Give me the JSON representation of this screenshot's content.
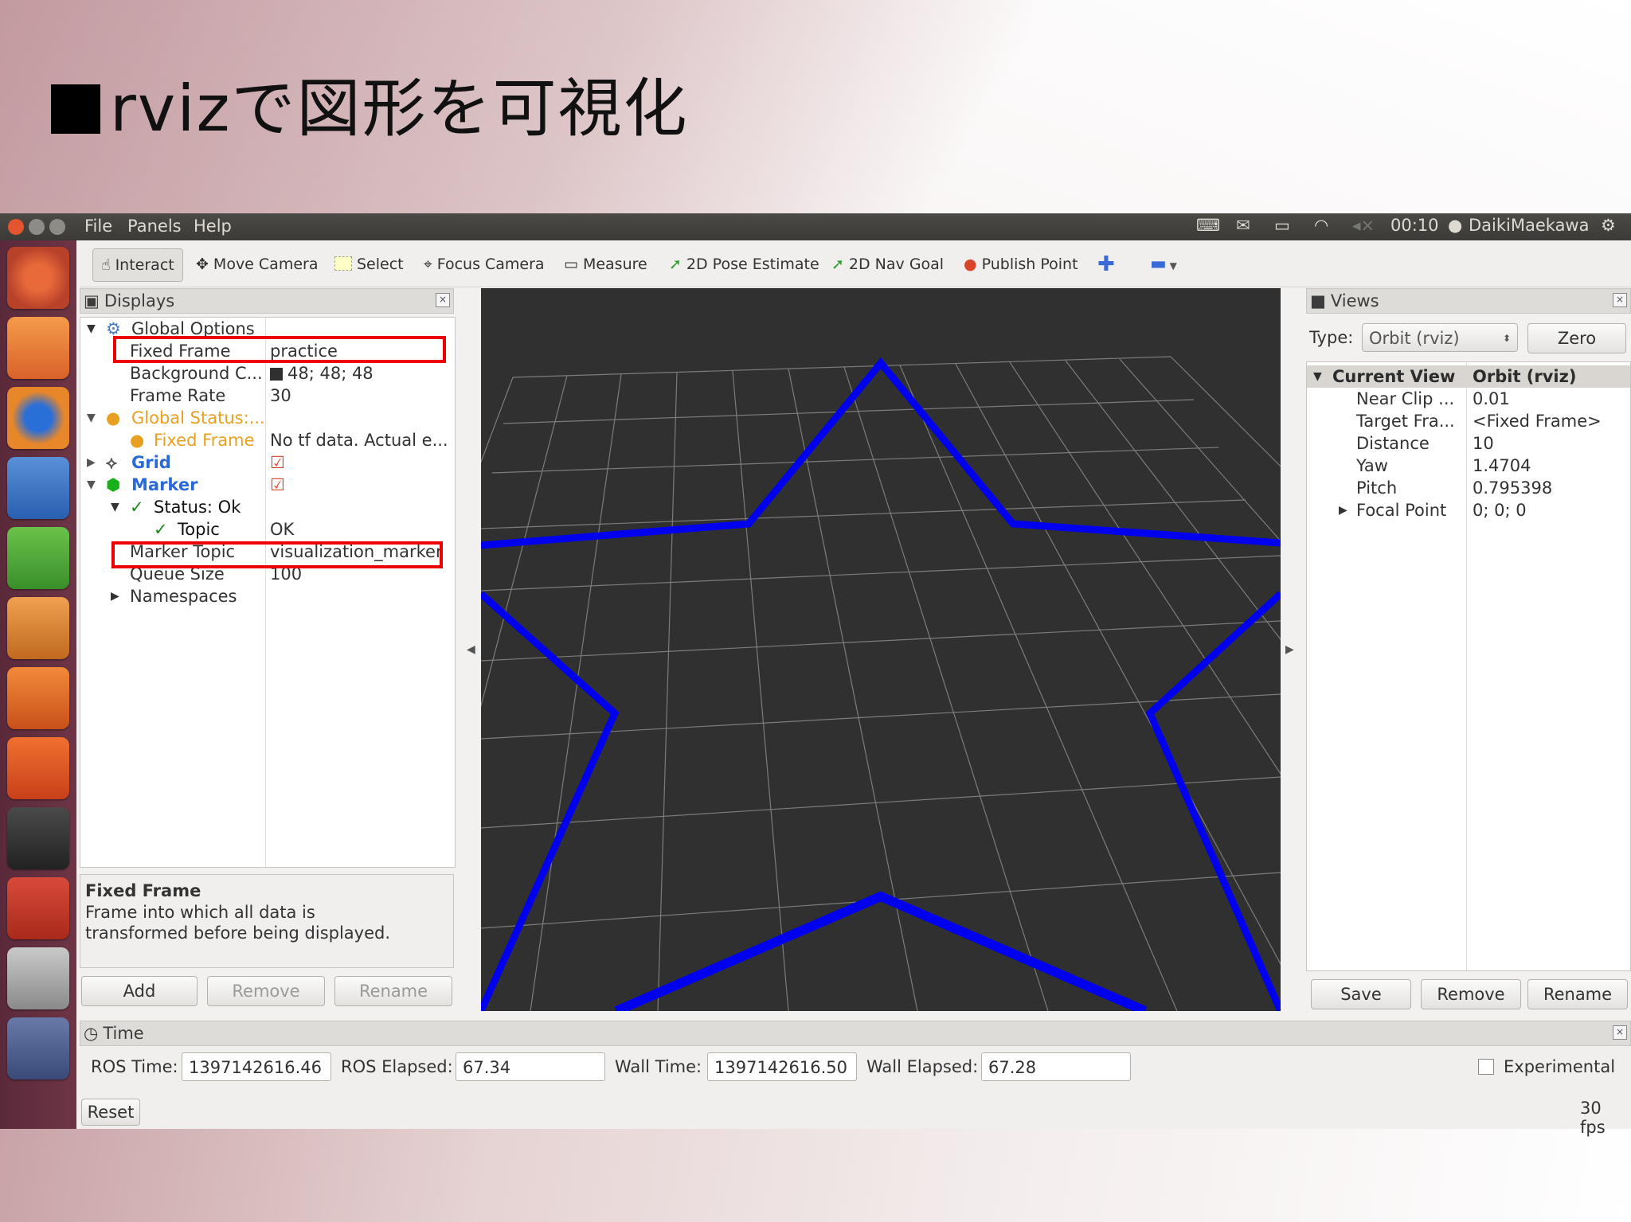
{
  "slide": {
    "title": "rvizで図形を可視化"
  },
  "topbar": {
    "menus": [
      "File",
      "Panels",
      "Help"
    ],
    "clock": "00:10",
    "user": "DaikiMaekawa"
  },
  "toolbar": {
    "interact": "Interact",
    "move_camera": "Move Camera",
    "select": "Select",
    "focus_camera": "Focus Camera",
    "measure": "Measure",
    "pose_estimate": "2D Pose Estimate",
    "nav_goal": "2D Nav Goal",
    "publish_point": "Publish Point"
  },
  "displays": {
    "title": "Displays",
    "rows": {
      "global_options": "Global Options",
      "fixed_frame_label": "Fixed Frame",
      "fixed_frame_value": "practice",
      "background_label": "Background C...",
      "background_value": "48; 48; 48",
      "frame_rate_label": "Frame Rate",
      "frame_rate_value": "30",
      "global_status": "Global Status:...",
      "status_fixed_frame": "Fixed Frame",
      "status_fixed_frame_value": "No tf data.  Actual e...",
      "grid": "Grid",
      "marker": "Marker",
      "status_ok": "Status: Ok",
      "topic": "Topic",
      "topic_value": "OK",
      "marker_topic_label": "Marker Topic",
      "marker_topic_value": "visualization_marker",
      "queue_size_label": "Queue Size",
      "queue_size_value": "100",
      "namespaces": "Namespaces"
    },
    "description_title": "Fixed Frame",
    "description_body": "Frame into which all data is transformed before being displayed.",
    "buttons": {
      "add": "Add",
      "remove": "Remove",
      "rename": "Rename"
    }
  },
  "views": {
    "title": "Views",
    "type_label": "Type:",
    "type_value": "Orbit (rviz)",
    "zero": "Zero",
    "header_name": "Current View",
    "header_value": "Orbit (rviz)",
    "rows": [
      {
        "name": "Near Clip ...",
        "value": "0.01"
      },
      {
        "name": "Target Fra...",
        "value": "<Fixed Frame>"
      },
      {
        "name": "Distance",
        "value": "10"
      },
      {
        "name": "Yaw",
        "value": "1.4704"
      },
      {
        "name": "Pitch",
        "value": "0.795398"
      },
      {
        "name": "Focal Point",
        "value": "0; 0; 0"
      }
    ],
    "buttons": {
      "save": "Save",
      "remove": "Remove",
      "rename": "Rename"
    }
  },
  "time": {
    "title": "Time",
    "ros_time_label": "ROS Time:",
    "ros_time": "1397142616.46",
    "ros_elapsed_label": "ROS Elapsed:",
    "ros_elapsed": "67.34",
    "wall_time_label": "Wall Time:",
    "wall_time": "1397142616.50",
    "wall_elapsed_label": "Wall Elapsed:",
    "wall_elapsed": "67.28",
    "experimental": "Experimental",
    "reset": "Reset",
    "fps": "30 fps"
  },
  "colors": {
    "marker_line": "#0000ee",
    "viewport_bg": "#303030",
    "highlight": "#ee0000"
  }
}
